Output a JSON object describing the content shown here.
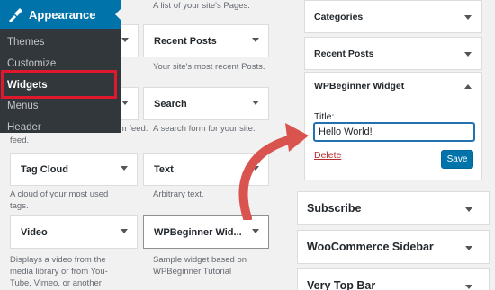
{
  "admin_menu": {
    "section": "Appearance",
    "items": [
      "Themes",
      "Customize",
      "Widgets",
      "Menus",
      "Header"
    ],
    "active": "Widgets"
  },
  "available_widgets": {
    "top_desc_fragment": "A list of your site's Pages.",
    "recent_posts": {
      "title": "Recent Posts",
      "desc": "Your site's most recent Posts."
    },
    "search": {
      "title": "Search",
      "desc": "A search form for your site."
    },
    "rss_desc_fragment": "Entries from any RSS or Atom feed.",
    "rss_desc_line2": "feed.",
    "tag_cloud": {
      "title": "Tag Cloud",
      "desc_l1": "A cloud of your most used",
      "desc_l2": "tags."
    },
    "text": {
      "title": "Text",
      "desc": "Arbitrary text."
    },
    "video": {
      "title": "Video",
      "desc_l1": "Displays a video from the",
      "desc_l2": "media library or from You-",
      "desc_l3": "Tube, Vimeo, or another"
    },
    "wpbeginner": {
      "title": "WPBeginner Wid...",
      "desc_l1": "Sample widget based on",
      "desc_l2": "WPBeginner Tutorial"
    }
  },
  "sidebar_widgets": {
    "categories": "Categories",
    "recent_posts": "Recent Posts",
    "wpbeginner": "WPBeginner Widget",
    "title_label": "Title:",
    "title_value": "Hello World!",
    "delete_label": "Delete",
    "save_label": "Save"
  },
  "widget_areas": [
    "Subscribe",
    "WooCommerce Sidebar",
    "Very Top Bar"
  ],
  "colors": {
    "admin_blue": "#0073aa",
    "admin_dark": "#32373c",
    "highlight_red": "#e0182d",
    "arrow_red": "#d9534f"
  }
}
